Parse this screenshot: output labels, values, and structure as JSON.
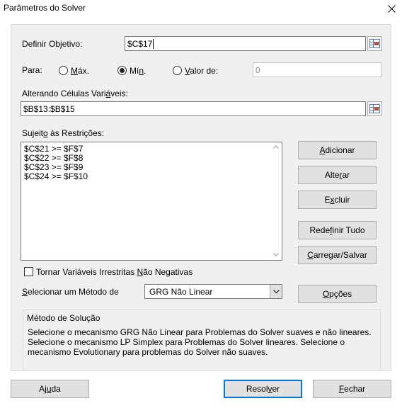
{
  "window": {
    "title": "Parâmetros do Solver"
  },
  "objective": {
    "label_pre": "Definir Ob",
    "label_u": "j",
    "label_post": "etivo:",
    "value": "$C$17"
  },
  "to": {
    "label": "Para:",
    "options": [
      {
        "pre": "",
        "u": "M",
        "post": "áx.",
        "selected": false
      },
      {
        "pre": "Mí",
        "u": "n",
        "post": ".",
        "selected": true
      },
      {
        "pre": "",
        "u": "V",
        "post": "alor de:",
        "selected": false
      }
    ],
    "value_of": "0"
  },
  "changing": {
    "label_pre": "Alterando Células Vari",
    "label_u": "á",
    "label_post": "veis:",
    "value": "$B$13:$B$15"
  },
  "constraints": {
    "label_pre": "Sujeit",
    "label_u": "o",
    "label_post": " às Restrições:",
    "items": [
      "$C$21 >= $F$7",
      "$C$22 >= $F$8",
      "$C$23 >= $F$9",
      "$C$24 >= $F$10"
    ]
  },
  "side_buttons": [
    {
      "name": "add-button",
      "pre": "",
      "u": "A",
      "post": "dicionar"
    },
    {
      "name": "change-button",
      "pre": "Alte",
      "u": "r",
      "post": "ar"
    },
    {
      "name": "delete-button",
      "pre": "E",
      "u": "x",
      "post": "cluir"
    },
    {
      "name": "reset-all-button",
      "pre": "Rede",
      "u": "f",
      "post": "inir Tudo"
    },
    {
      "name": "load-save-button",
      "pre": "",
      "u": "C",
      "post": "arregar/Salvar"
    }
  ],
  "nonneg": {
    "pre": "Tornar Variáveis Irrestritas ",
    "u": "N",
    "post": "ão Negativas",
    "checked": false
  },
  "method": {
    "label_pre": "",
    "label_u": "S",
    "label_post": "elecionar um Método de",
    "selected": "GRG Não Linear",
    "options_button": {
      "pre": "",
      "u": "O",
      "post": "pções"
    }
  },
  "solution_method": {
    "title": "Método de Solução",
    "description": "Selecione o mecanismo GRG Não Linear para Problemas do Solver suaves e não lineares. Selecione o mecanismo LP Simplex para Problemas do Solver lineares. Selecione o mecanismo Evolutionary para problemas do Solver não suaves."
  },
  "footer": {
    "help": {
      "pre": "Aj",
      "u": "u",
      "post": "da"
    },
    "solve": {
      "pre": "Resol",
      "u": "v",
      "post": "er"
    },
    "close": {
      "pre": "",
      "u": "F",
      "post": "echar"
    }
  },
  "colors": {
    "default_button_border": "#0078d7",
    "panel_bg": "#f0f0f0",
    "button_bg": "#e1e1e1"
  }
}
